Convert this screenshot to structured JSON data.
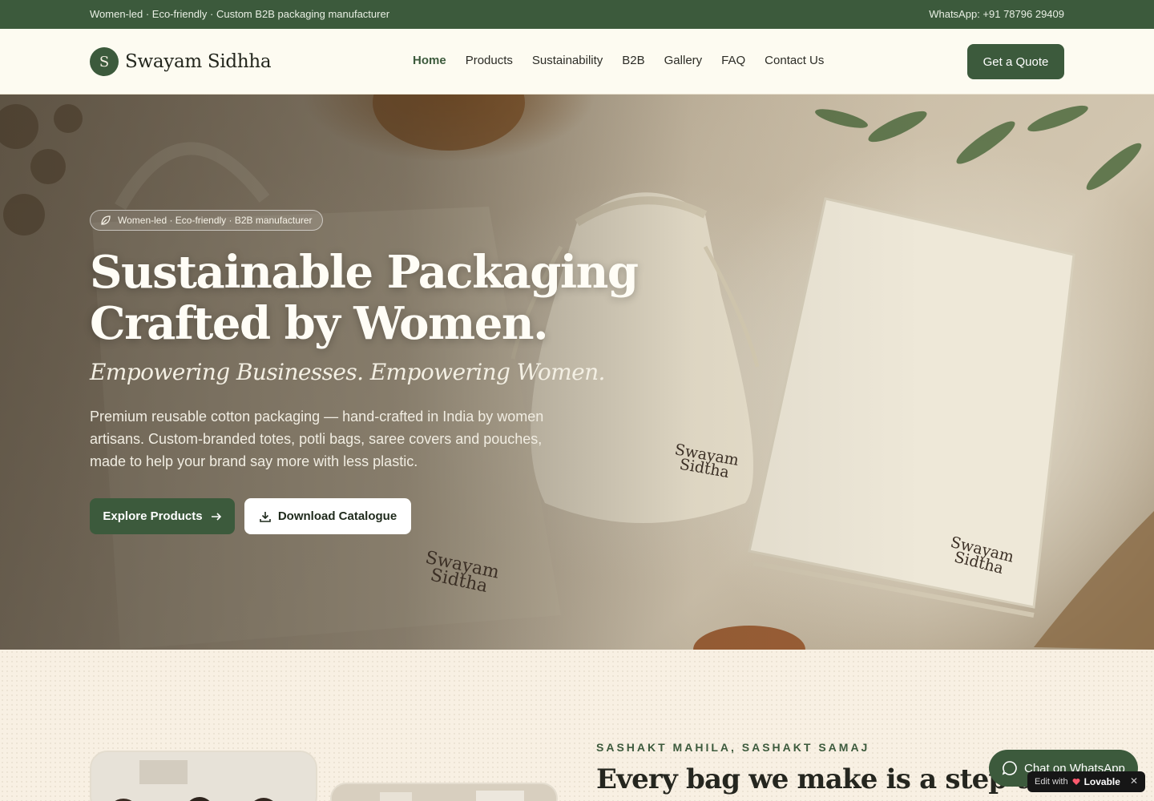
{
  "topbar": {
    "tagline": "Women-led · Eco-friendly · Custom B2B packaging manufacturer",
    "whatsapp": "WhatsApp: +91 78796 29409"
  },
  "header": {
    "logo_letter": "S",
    "brand": "Swayam Sidhha",
    "nav": [
      "Home",
      "Products",
      "Sustainability",
      "B2B",
      "Gallery",
      "FAQ",
      "Contact Us"
    ],
    "active_nav": "Home",
    "quote_button": "Get a Quote"
  },
  "hero": {
    "badge": "Women-led · Eco-friendly · B2B manufacturer",
    "title_line1": "Sustainable Packaging",
    "title_line2": "Crafted by Women.",
    "subtitle": "Empowering Businesses. Empowering Women.",
    "description": "Premium reusable cotton packaging — hand-crafted in India by women artisans. Custom-branded totes, potli bags, saree covers and pouches, made to help your brand say more with less plastic.",
    "primary_button": "Explore Products",
    "secondary_button": "Download Catalogue",
    "bag_print_line1": "Swayam",
    "bag_print_line2": "Sidtha"
  },
  "mission": {
    "eyebrow": "SASHAKT MAHILA, SASHAKT SAMAJ",
    "title": "Every bag we make is a step towa"
  },
  "widgets": {
    "whatsapp_chat": "Chat on WhatsApp",
    "edit_with": "Edit with",
    "lovable": "Lovable",
    "close": "✕"
  },
  "colors": {
    "brand_green": "#3c5a3c",
    "cream": "#fdfbf1",
    "section_bg": "#f8f0e3"
  }
}
